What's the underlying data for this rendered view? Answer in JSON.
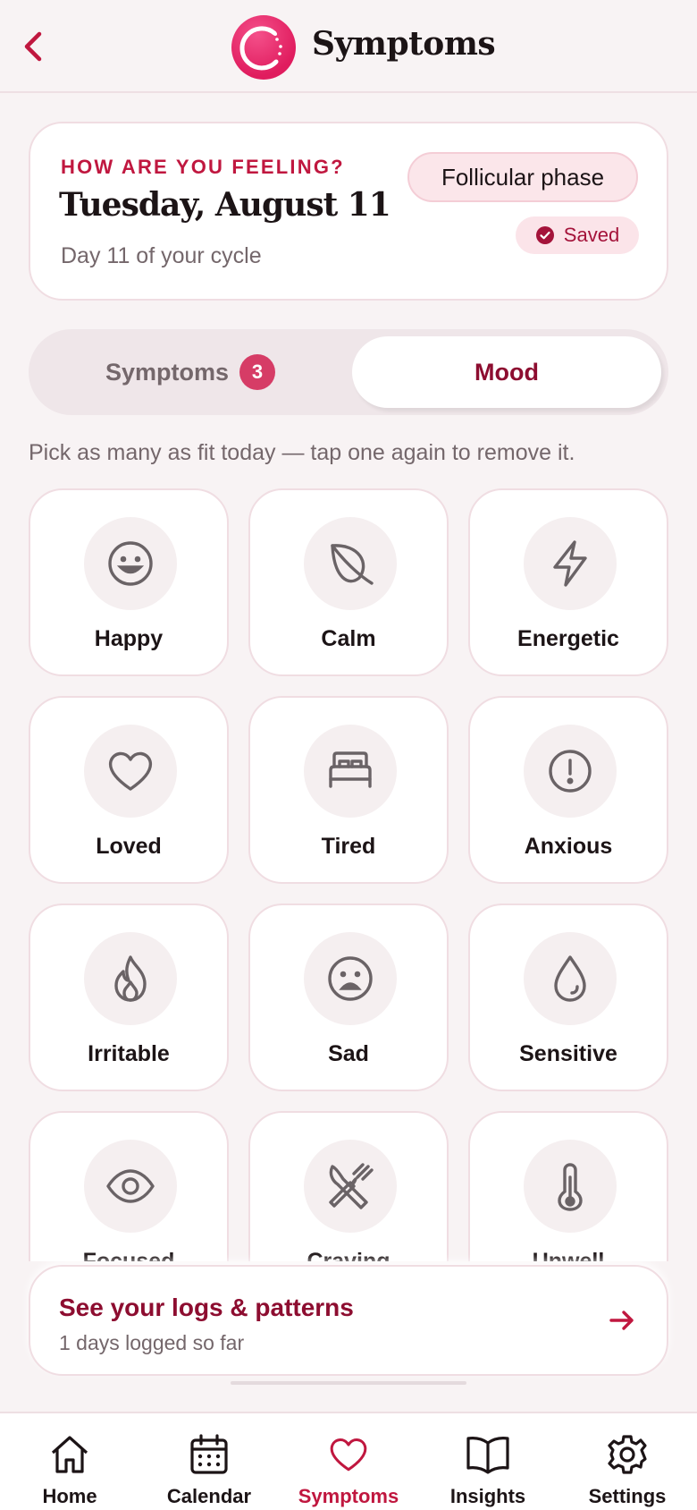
{
  "header": {
    "title": "Symptoms"
  },
  "summary": {
    "eyebrow": "HOW ARE YOU FEELING?",
    "date": "Tuesday, August 11",
    "cycle_day": "Day 11 of your cycle",
    "phase": "Follicular phase",
    "status": "Saved"
  },
  "segments": {
    "symptoms_label": "Symptoms",
    "symptoms_count": "3",
    "mood_label": "Mood",
    "active": "Mood"
  },
  "hint": "Pick as many as fit today — tap one again to remove it.",
  "moods": [
    {
      "label": "Happy",
      "icon": "smile-icon"
    },
    {
      "label": "Calm",
      "icon": "leaf-icon"
    },
    {
      "label": "Energetic",
      "icon": "lightning-icon"
    },
    {
      "label": "Loved",
      "icon": "heart-icon"
    },
    {
      "label": "Tired",
      "icon": "bed-icon"
    },
    {
      "label": "Anxious",
      "icon": "alert-circle-icon"
    },
    {
      "label": "Irritable",
      "icon": "flame-icon"
    },
    {
      "label": "Sad",
      "icon": "sad-face-icon"
    },
    {
      "label": "Sensitive",
      "icon": "droplet-icon"
    },
    {
      "label": "Focused",
      "icon": "eye-icon"
    },
    {
      "label": "Craving",
      "icon": "utensils-icon"
    },
    {
      "label": "Unwell",
      "icon": "thermometer-icon"
    }
  ],
  "logs_card": {
    "title": "See your logs & patterns",
    "subtitle": "1 days logged so far"
  },
  "tabs": [
    {
      "label": "Home",
      "icon": "home-icon"
    },
    {
      "label": "Calendar",
      "icon": "calendar-icon"
    },
    {
      "label": "Symptoms",
      "icon": "heart-icon"
    },
    {
      "label": "Insights",
      "icon": "book-icon"
    },
    {
      "label": "Settings",
      "icon": "gear-icon"
    }
  ],
  "colors": {
    "accent": "#c0173f",
    "accent_dark": "#8d0d30",
    "background": "#f8f3f4",
    "muted_text": "#74676b",
    "icon_gray": "#6a6366"
  }
}
